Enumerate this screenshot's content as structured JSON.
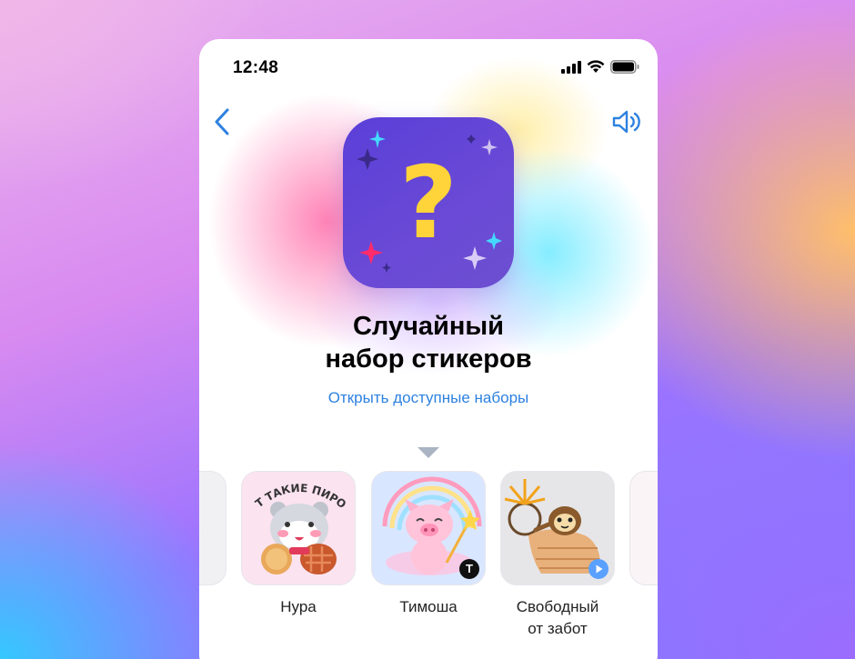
{
  "status_bar": {
    "time": "12:48"
  },
  "header": {
    "back_icon": "chevron-left-icon",
    "sound_icon": "speaker-icon"
  },
  "hero": {
    "icon": "question-mark-icon",
    "title_line1": "Случайный",
    "title_line2": "набор стикеров",
    "link": "Открыть доступные наборы"
  },
  "stickers": [
    {
      "name": "Нура",
      "caption": "ВОТ ТАКИЕ ПИРОГИ"
    },
    {
      "name": "Тимоша",
      "badge": "Т"
    },
    {
      "name_line1": "Свободный",
      "name_line2": "от забот",
      "badge": "play-icon"
    }
  ],
  "colors": {
    "accent": "#2d81e0",
    "icon_bg": "#5a3fd8",
    "question": "#ffd43a"
  }
}
